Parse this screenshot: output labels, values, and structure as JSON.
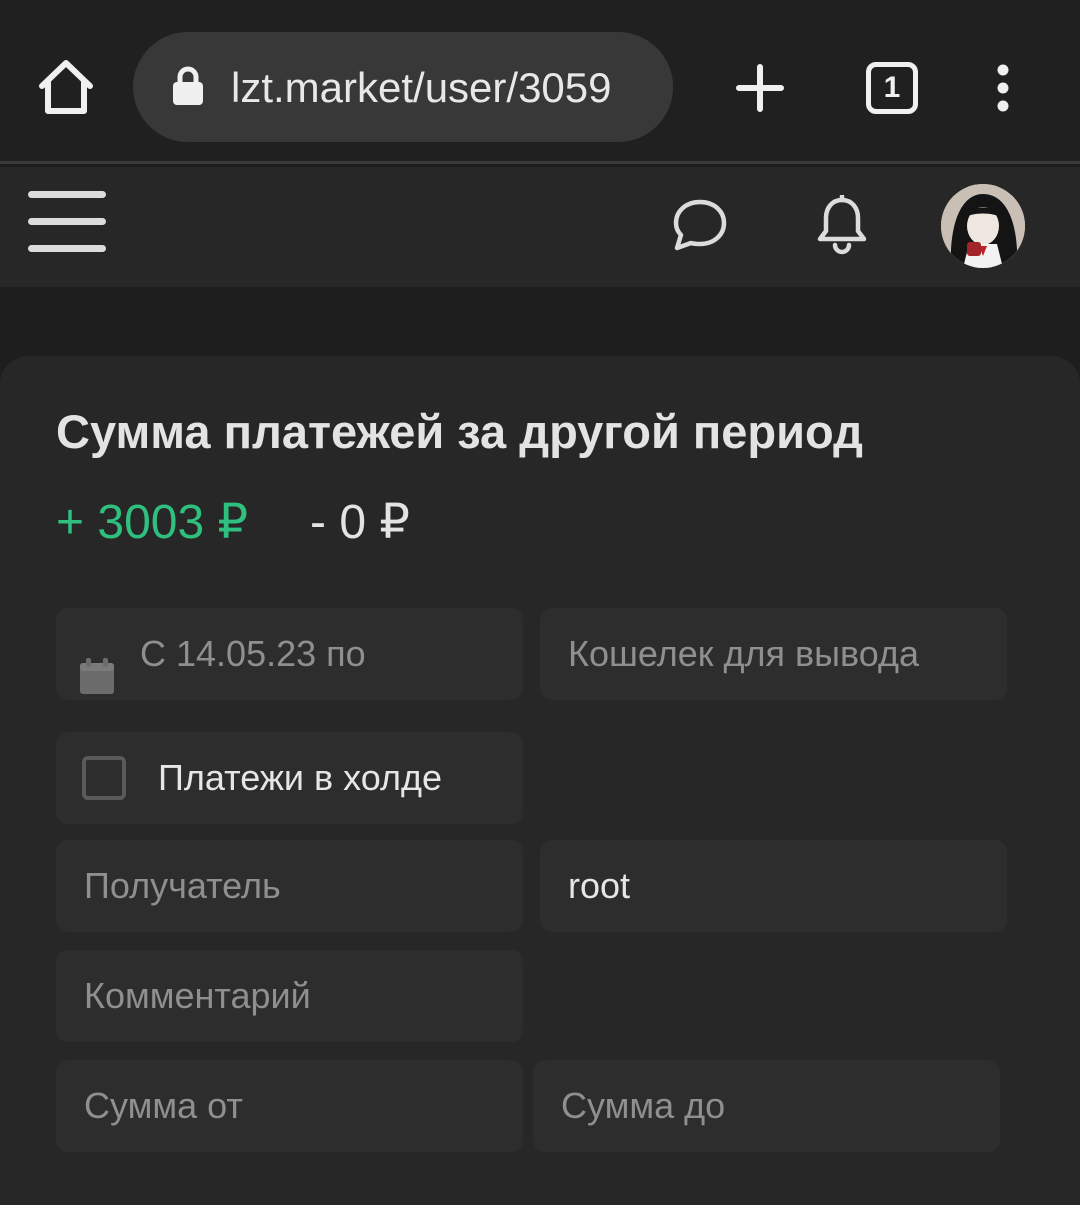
{
  "browser": {
    "url": "lzt.market/user/3059",
    "tab_count": "1",
    "icons": [
      "home-icon",
      "lock-icon",
      "plus-icon",
      "tabs-icon",
      "more-vert-icon"
    ]
  },
  "header": {
    "icons": [
      "hamburger-menu-icon",
      "chat-icon",
      "bell-icon",
      "avatar"
    ]
  },
  "card": {
    "title": "Сумма платежей за другой период",
    "income": "+ 3003 ₽",
    "expense": "- 0 ₽",
    "income_color": "#2fbf7f"
  },
  "filters": {
    "date_range": "С 14.05.23 по",
    "wallet_placeholder": "Кошелек для вывода",
    "hold_label": "Платежи в холде",
    "recipient_placeholder": "Получатель",
    "sender_value": "root",
    "comment_placeholder": "Комментарий",
    "amount_from_placeholder": "Сумма от",
    "amount_to_placeholder": "Сумма до"
  }
}
